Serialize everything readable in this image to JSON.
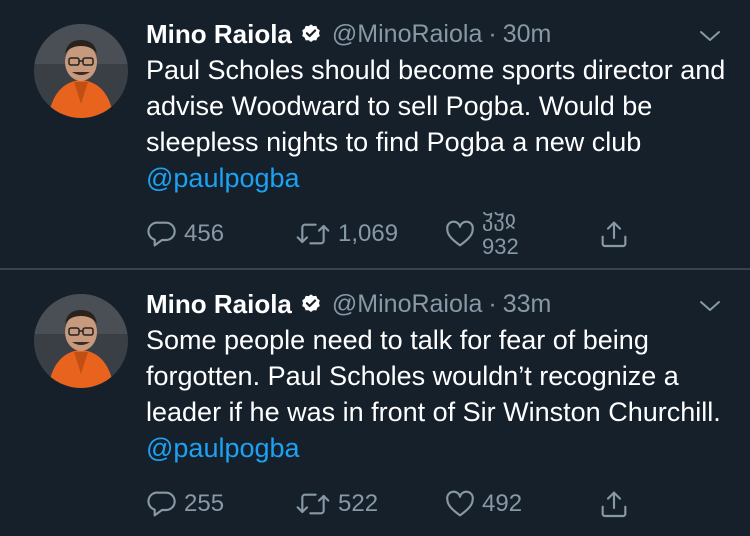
{
  "tweets": [
    {
      "author_name": "Mino Raiola",
      "handle": "@MinoRaiola",
      "separator": "·",
      "time": "30m",
      "text": "Paul Scholes should become sports director and advise Woodward to sell Pogba. Would be sleepless nights to find Pogba a new club ",
      "mention": "@paulpogba",
      "replies": "456",
      "retweets": "1,069",
      "likes_rolling_top": "ჴჴჲ",
      "likes_rolling_bottom": "932"
    },
    {
      "author_name": "Mino Raiola",
      "handle": "@MinoRaiola",
      "separator": "·",
      "time": "33m",
      "text": "Some people need to talk for fear of being forgotten. Paul Scholes wouldn’t recognize a leader if he was in front of Sir Winston Churchill. ",
      "mention": "@paulpogba",
      "replies": "255",
      "retweets": "522",
      "likes": "492"
    }
  ],
  "icons": {
    "verified": "verified-badge-icon",
    "chevron": "chevron-down-icon",
    "reply": "reply-icon",
    "retweet": "retweet-icon",
    "like": "heart-icon",
    "share": "share-icon"
  },
  "colors": {
    "background": "#15202b",
    "secondary_text": "#8899a6",
    "link": "#1da1f2",
    "divider": "#38444d"
  }
}
